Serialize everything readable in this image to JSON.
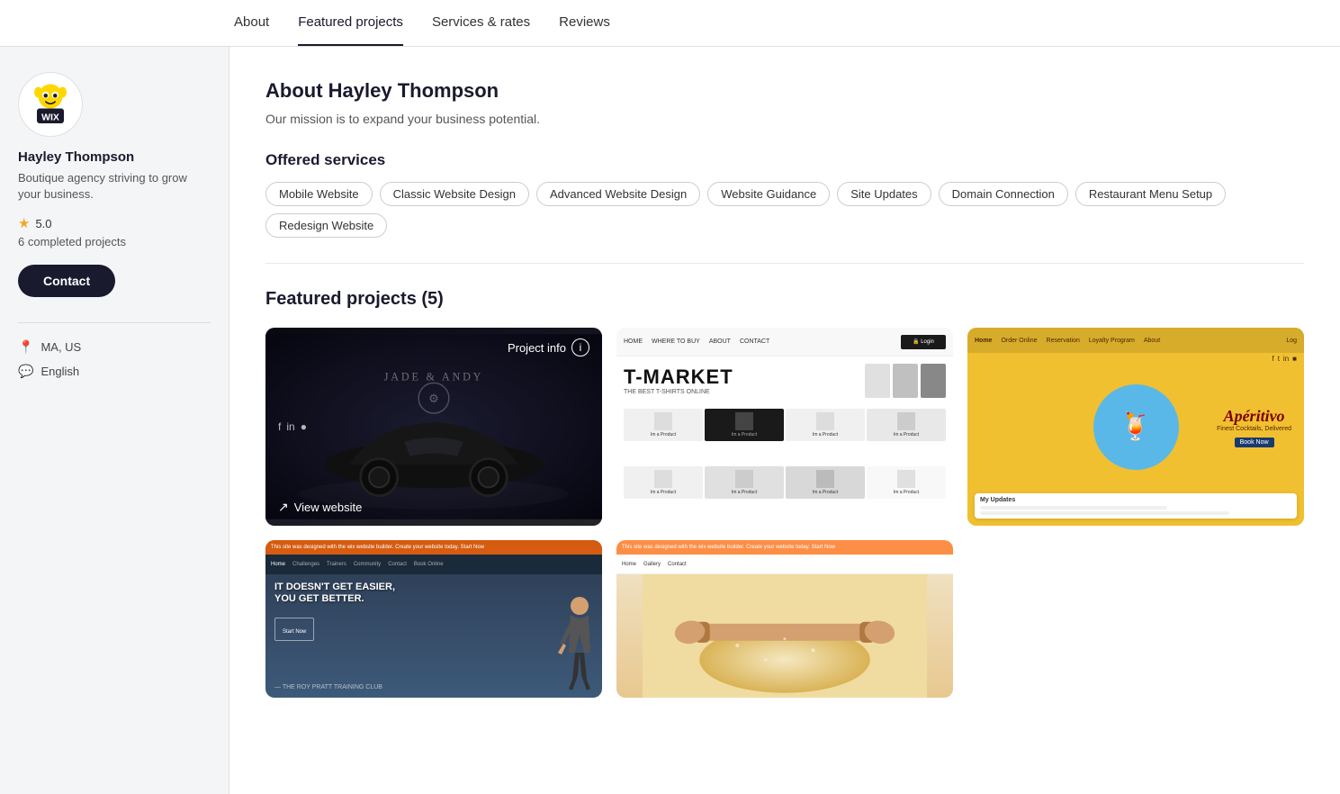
{
  "nav": {
    "items": [
      {
        "id": "about",
        "label": "About",
        "active": false
      },
      {
        "id": "featured",
        "label": "Featured projects",
        "active": true
      },
      {
        "id": "services",
        "label": "Services & rates",
        "active": false
      },
      {
        "id": "reviews",
        "label": "Reviews",
        "active": false
      }
    ]
  },
  "sidebar": {
    "name": "Hayley Thompson",
    "description": "Boutique agency striving to grow your business.",
    "rating": "5.0",
    "completed": "6 completed projects",
    "contact_label": "Contact",
    "location": "MA, US",
    "language": "English"
  },
  "about": {
    "title": "About Hayley Thompson",
    "subtitle": "Our mission is to expand your business potential.",
    "offered_services_title": "Offered services",
    "services": [
      "Mobile Website",
      "Classic Website Design",
      "Advanced Website Design",
      "Website Guidance",
      "Site Updates",
      "Domain Connection",
      "Restaurant Menu Setup",
      "Redesign Website"
    ]
  },
  "featured": {
    "title": "Featured projects (5)",
    "projects": [
      {
        "id": 1,
        "title": "Jade & Andy - Car Site",
        "type": "car",
        "show_overlay": true,
        "info_label": "Project info",
        "view_label": "View website"
      },
      {
        "id": 2,
        "title": "T-Market",
        "type": "tmarket",
        "show_overlay": false
      },
      {
        "id": 3,
        "title": "Aperitivo",
        "type": "aperitivo",
        "show_overlay": false
      },
      {
        "id": 4,
        "title": "Fitness Club",
        "type": "fitness",
        "show_overlay": false
      },
      {
        "id": 5,
        "title": "Pizza / Food",
        "type": "pizza",
        "show_overlay": false
      }
    ]
  },
  "colors": {
    "primary": "#1a1a2e",
    "accent": "#f5a623",
    "bg": "#f4f5f7",
    "tag_border": "#ccc"
  }
}
